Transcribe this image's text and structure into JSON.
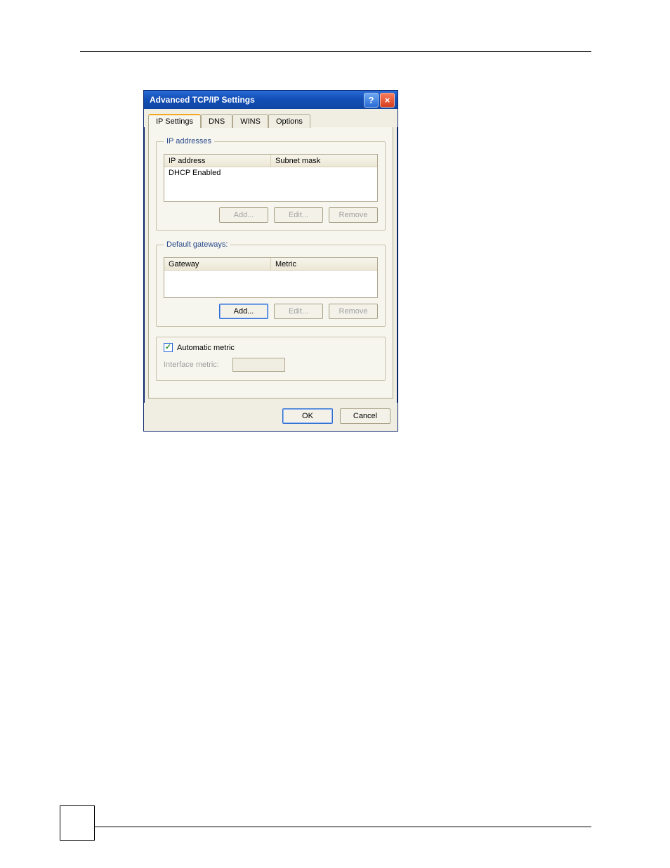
{
  "dialog": {
    "title": "Advanced TCP/IP Settings",
    "titlebar": {
      "help_icon": "?",
      "close_icon": "×"
    },
    "tabs": [
      {
        "label": "IP Settings",
        "active": true
      },
      {
        "label": "DNS",
        "active": false
      },
      {
        "label": "WINS",
        "active": false
      },
      {
        "label": "Options",
        "active": false
      }
    ],
    "ip_addresses": {
      "legend": "IP addresses",
      "columns": {
        "c1": "IP address",
        "c2": "Subnet mask"
      },
      "rows": [
        {
          "c1": "DHCP Enabled",
          "c2": ""
        }
      ],
      "buttons": {
        "add": {
          "label": "Add...",
          "enabled": false
        },
        "edit": {
          "label": "Edit...",
          "enabled": false
        },
        "remove": {
          "label": "Remove",
          "enabled": false
        }
      }
    },
    "default_gateways": {
      "legend": "Default gateways:",
      "columns": {
        "c1": "Gateway",
        "c2": "Metric"
      },
      "rows": [],
      "buttons": {
        "add": {
          "label": "Add...",
          "enabled": true
        },
        "edit": {
          "label": "Edit...",
          "enabled": false
        },
        "remove": {
          "label": "Remove",
          "enabled": false
        }
      }
    },
    "metric": {
      "auto_label": "Automatic metric",
      "auto_checked": true,
      "interface_label": "Interface metric:",
      "interface_value": ""
    },
    "footer": {
      "ok": "OK",
      "cancel": "Cancel"
    }
  }
}
